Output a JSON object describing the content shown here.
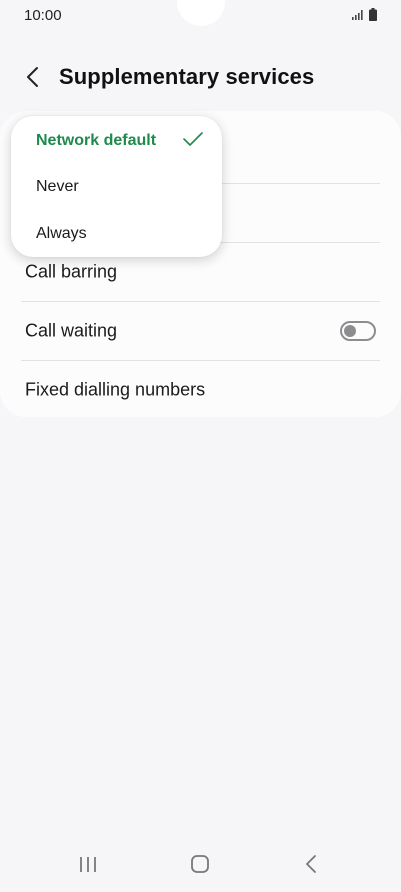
{
  "status_bar": {
    "time": "10:00"
  },
  "header": {
    "title": "Supplementary services"
  },
  "dropdown": {
    "options": [
      {
        "label": "Network default",
        "selected": true
      },
      {
        "label": "Never",
        "selected": false
      },
      {
        "label": "Always",
        "selected": false
      }
    ]
  },
  "list": {
    "call_barring": "Call barring",
    "call_waiting": {
      "label": "Call waiting",
      "enabled": false
    },
    "fixed_dialling": "Fixed dialling numbers"
  },
  "colors": {
    "accent": "#1f8a4c",
    "background": "#f6f6f8",
    "card": "#fcfcfd",
    "toggle_off": "#8d8d8f"
  },
  "icons": {
    "back": "chevron-left-icon",
    "check": "check-icon",
    "nav_recents": "recents-icon",
    "nav_home": "home-icon",
    "nav_back": "back-nav-icon"
  }
}
